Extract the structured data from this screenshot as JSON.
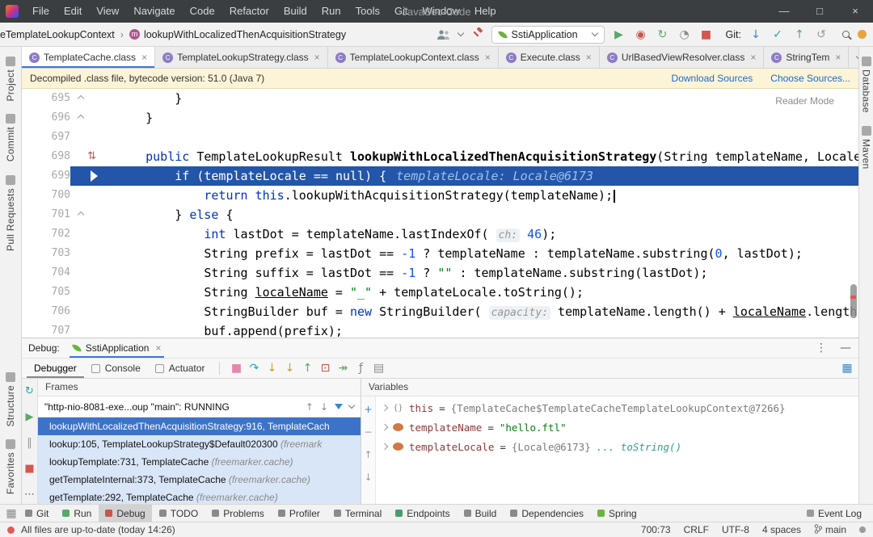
{
  "window": {
    "title": "JavaSec-Code",
    "controls": [
      {
        "name": "minimize",
        "glyph": "—"
      },
      {
        "name": "maximize",
        "glyph": "□"
      },
      {
        "name": "close",
        "glyph": "×"
      }
    ]
  },
  "menus": [
    "File",
    "Edit",
    "View",
    "Navigate",
    "Code",
    "Refactor",
    "Build",
    "Run",
    "Tools",
    "Git",
    "Window",
    "Help"
  ],
  "nav": {
    "breadcrumb_class": "eTemplateLookupContext",
    "separator": "›",
    "breadcrumb_method": "lookupWithLocalizedThenAcquisitionStrategy",
    "run_config": "SstiApplication",
    "git_label": "Git:",
    "run_icons": [
      {
        "name": "run-button",
        "glyph": "▶",
        "color": "#59a869"
      },
      {
        "name": "debug-bug-button",
        "glyph": "◉",
        "color": "#c75450"
      },
      {
        "name": "coverage-button",
        "glyph": "↻",
        "color": "#59a869"
      },
      {
        "name": "profiler-button",
        "glyph": "◔",
        "color": "#8a8a8a"
      },
      {
        "name": "stop-button",
        "glyph": "■",
        "color": "#d4564e"
      }
    ],
    "git_icons": [
      {
        "name": "update-project-icon",
        "glyph": "↓",
        "color": "#3e86c9"
      },
      {
        "name": "commit-icon",
        "glyph": "✓",
        "color": "#2aa4a8"
      },
      {
        "name": "push-icon",
        "glyph": "↑",
        "color": "#59a869"
      },
      {
        "name": "rollback-icon",
        "glyph": "↺",
        "color": "#9a9a9a"
      }
    ]
  },
  "editor_tabs": [
    {
      "label": "TemplateCache.class",
      "active": true
    },
    {
      "label": "TemplateLookupStrategy.class",
      "active": false
    },
    {
      "label": "TemplateLookupContext.class",
      "active": false
    },
    {
      "label": "Execute.class",
      "active": false
    },
    {
      "label": "UrlBasedViewResolver.class",
      "active": false
    },
    {
      "label": "StringTem",
      "active": false
    }
  ],
  "banner": {
    "message": "Decompiled .class file, bytecode version: 51.0 (Java 7)",
    "links": [
      "Download Sources",
      "Choose Sources..."
    ]
  },
  "editor": {
    "reader_mode_label": "Reader Mode",
    "lines": [
      {
        "num": "695",
        "fold": "up",
        "segments": [
          {
            "t": "        }",
            "c": "pln"
          }
        ]
      },
      {
        "num": "696",
        "fold": "up",
        "segments": [
          {
            "t": "    }",
            "c": "pln"
          }
        ]
      },
      {
        "num": "697",
        "segments": []
      },
      {
        "num": "698",
        "icon": "updown",
        "segments": [
          {
            "t": "    ",
            "c": "pln"
          },
          {
            "t": "public",
            "c": "kw"
          },
          {
            "t": " TemplateLookupResult ",
            "c": "pln"
          },
          {
            "t": "lookupWithLocalizedThenAcquisitionStrategy",
            "c": "decl"
          },
          {
            "t": "(String templateName, Locale tem",
            "c": "pln"
          }
        ]
      },
      {
        "num": "699",
        "exec": true,
        "hint": "templateLocale: Locale@6173",
        "segments": [
          {
            "t": "        ",
            "c": "pln"
          },
          {
            "t": "if",
            "c": "kw"
          },
          {
            "t": " (templateLocale == ",
            "c": "pln"
          },
          {
            "t": "null",
            "c": "kw"
          },
          {
            "t": ") {",
            "c": "pln"
          }
        ]
      },
      {
        "num": "700",
        "caret": true,
        "segments": [
          {
            "t": "            ",
            "c": "pln"
          },
          {
            "t": "return",
            "c": "kw"
          },
          {
            "t": " ",
            "c": "pln"
          },
          {
            "t": "this",
            "c": "kw"
          },
          {
            "t": ".lookupWithAcquisitionStrategy(templateName);",
            "c": "pln"
          }
        ]
      },
      {
        "num": "701",
        "fold": "up",
        "segments": [
          {
            "t": "        } ",
            "c": "pln"
          },
          {
            "t": "else",
            "c": "kw"
          },
          {
            "t": " {",
            "c": "pln"
          }
        ]
      },
      {
        "num": "702",
        "segments": [
          {
            "t": "            ",
            "c": "pln"
          },
          {
            "t": "int",
            "c": "kw"
          },
          {
            "t": " lastDot = templateName.lastIndexOf( ",
            "c": "pln"
          },
          {
            "t": "ch:",
            "c": "hint"
          },
          {
            "t": " ",
            "c": "pln"
          },
          {
            "t": "46",
            "c": "num"
          },
          {
            "t": ");",
            "c": "pln"
          }
        ]
      },
      {
        "num": "703",
        "segments": [
          {
            "t": "            String prefix = lastDot == ",
            "c": "pln"
          },
          {
            "t": "-1",
            "c": "num"
          },
          {
            "t": " ? templateName : templateName.substring(",
            "c": "pln"
          },
          {
            "t": "0",
            "c": "num"
          },
          {
            "t": ", lastDot);",
            "c": "pln"
          }
        ]
      },
      {
        "num": "704",
        "segments": [
          {
            "t": "            String suffix = lastDot == ",
            "c": "pln"
          },
          {
            "t": "-1",
            "c": "num"
          },
          {
            "t": " ? ",
            "c": "pln"
          },
          {
            "t": "\"\"",
            "c": "str"
          },
          {
            "t": " : templateName.substring(lastDot);",
            "c": "pln"
          }
        ]
      },
      {
        "num": "705",
        "segments": [
          {
            "t": "            String ",
            "c": "pln"
          },
          {
            "t": "localeName",
            "c": "und"
          },
          {
            "t": " = ",
            "c": "pln"
          },
          {
            "t": "\"_\"",
            "c": "str"
          },
          {
            "t": " + templateLocale.toString();",
            "c": "pln"
          }
        ]
      },
      {
        "num": "706",
        "segments": [
          {
            "t": "            StringBuilder buf = ",
            "c": "pln"
          },
          {
            "t": "new",
            "c": "kw"
          },
          {
            "t": " StringBuilder( ",
            "c": "pln"
          },
          {
            "t": "capacity:",
            "c": "hint"
          },
          {
            "t": " templateName.length() + ",
            "c": "pln"
          },
          {
            "t": "localeName",
            "c": "und"
          },
          {
            "t": ".length());",
            "c": "pln"
          }
        ]
      },
      {
        "num": "707",
        "segments": [
          {
            "t": "            buf.append(prefix);",
            "c": "pln"
          }
        ]
      }
    ]
  },
  "left_stripe": {
    "top": [
      "Project",
      "Commit",
      "Pull Requests"
    ],
    "bottom": [
      "Structure",
      "Favorites"
    ]
  },
  "right_stripe": [
    "Database",
    "Maven"
  ],
  "debug": {
    "label": "Debug:",
    "session_tab": "SstiApplication",
    "tool_tabs": [
      "Debugger",
      "Console",
      "Actuator"
    ],
    "toolbar_icons": [
      {
        "name": "mute-breakpoints-icon",
        "glyph": "■",
        "color": "#e586ad"
      },
      {
        "name": "step-over-icon",
        "glyph": "↷",
        "color": "#2aa4a8"
      },
      {
        "name": "step-into-icon",
        "glyph": "↓",
        "color": "#c9a227"
      },
      {
        "name": "force-step-into-icon",
        "glyph": "↓",
        "color": "#c9a227"
      },
      {
        "name": "step-out-icon",
        "glyph": "↑",
        "color": "#59a869"
      },
      {
        "name": "drop-frame-icon",
        "glyph": "⊡",
        "color": "#c75450"
      },
      {
        "name": "run-to-cursor-icon",
        "glyph": "↠",
        "color": "#59a869"
      },
      {
        "name": "evaluate-expression-icon",
        "glyph": "ƒ",
        "color": "#8a8a8a"
      },
      {
        "name": "layout-settings-icon",
        "glyph": "▤",
        "color": "#8a8a8a"
      }
    ],
    "restore_layout_glyph": "▦",
    "strip_icons": [
      {
        "name": "rerun-icon",
        "glyph": "↻",
        "color": "#2aa4a8"
      },
      {
        "name": "resume-icon",
        "glyph": "▶",
        "color": "#59a869"
      },
      {
        "name": "pause-icon",
        "glyph": "‖",
        "color": "#9a9a9a"
      },
      {
        "name": "stop-icon",
        "glyph": "■",
        "color": "#d4564e"
      },
      {
        "name": "more-icon",
        "glyph": "⋯",
        "color": "#666666"
      }
    ],
    "frames": {
      "header": "Frames",
      "thread": "\"http-nio-8081-exe...oup \"main\": RUNNING",
      "rows": [
        {
          "main": "lookupWithLocalizedThenAcquisitionStrategy:916, TemplateCach",
          "pkg": "",
          "selected": true
        },
        {
          "main": "lookup:105, TemplateLookupStrategy$Default020300 ",
          "pkg": "(freemark",
          "selected": false
        },
        {
          "main": "lookupTemplate:731, TemplateCache ",
          "pkg": "(freemarker.cache)",
          "selected": false
        },
        {
          "main": "getTemplateInternal:373, TemplateCache ",
          "pkg": "(freemarker.cache)",
          "selected": false
        },
        {
          "main": "getTemplate:292, TemplateCache ",
          "pkg": "(freemarker.cache)",
          "selected": false
        }
      ]
    },
    "variables": {
      "header": "Variables",
      "strip_icons": [
        {
          "name": "add-watch-icon",
          "glyph": "+",
          "color": "#3e86c9"
        },
        {
          "name": "remove-watch-icon",
          "glyph": "−",
          "color": "#9a9a9a"
        },
        {
          "name": "move-up-icon",
          "glyph": "↑",
          "color": "#9a9a9a"
        },
        {
          "name": "move-down-icon",
          "glyph": "↓",
          "color": "#9a9a9a"
        }
      ],
      "rows": [
        {
          "icon": "braces",
          "name": "this",
          "eq": " = ",
          "value": "{TemplateCache$TemplateCacheTemplateLookupContext@7266}",
          "vtype": "ref",
          "extra": ""
        },
        {
          "icon": "field",
          "name": "templateName",
          "eq": " = ",
          "value": "\"hello.ftl\"",
          "vtype": "str",
          "extra": ""
        },
        {
          "icon": "field",
          "name": "templateLocale",
          "eq": " = ",
          "value": "{Locale@6173}",
          "vtype": "ref",
          "extra": " ... toString()"
        }
      ]
    }
  },
  "toolwindow_bar": {
    "left": [
      {
        "label": "Git",
        "icon": "git-icon",
        "color": "#8a8a8a"
      },
      {
        "label": "Run",
        "icon": "run-icon",
        "color": "#59a869"
      },
      {
        "label": "Debug",
        "icon": "debug-icon",
        "color": "#c75450",
        "active": true
      },
      {
        "label": "TODO",
        "icon": "todo-icon",
        "color": "#8a8a8a"
      },
      {
        "label": "Problems",
        "icon": "problems-icon",
        "color": "#8a8a8a"
      },
      {
        "label": "Profiler",
        "icon": "profiler-icon",
        "color": "#8a8a8a"
      },
      {
        "label": "Terminal",
        "icon": "terminal-icon",
        "color": "#8a8a8a"
      },
      {
        "label": "Endpoints",
        "icon": "endpoints-icon",
        "color": "#4a9c6d"
      },
      {
        "label": "Build",
        "icon": "build-icon",
        "color": "#8a8a8a"
      },
      {
        "label": "Dependencies",
        "icon": "dependencies-icon",
        "color": "#8a8a8a"
      },
      {
        "label": "Spring",
        "icon": "spring-icon",
        "color": "#6db33f"
      }
    ],
    "right": {
      "label": "Event Log",
      "icon": "event-log-icon",
      "color": "#9a9a9a"
    }
  },
  "status_bar": {
    "message": "All files are up-to-date (today 14:26)",
    "items": [
      {
        "name": "cursor-position",
        "text": "700:73"
      },
      {
        "name": "line-separator",
        "text": "CRLF"
      },
      {
        "name": "file-encoding",
        "text": "UTF-8"
      },
      {
        "name": "indent-size",
        "text": "4 spaces"
      },
      {
        "name": "git-branch",
        "text": "main",
        "branch": true
      }
    ]
  }
}
